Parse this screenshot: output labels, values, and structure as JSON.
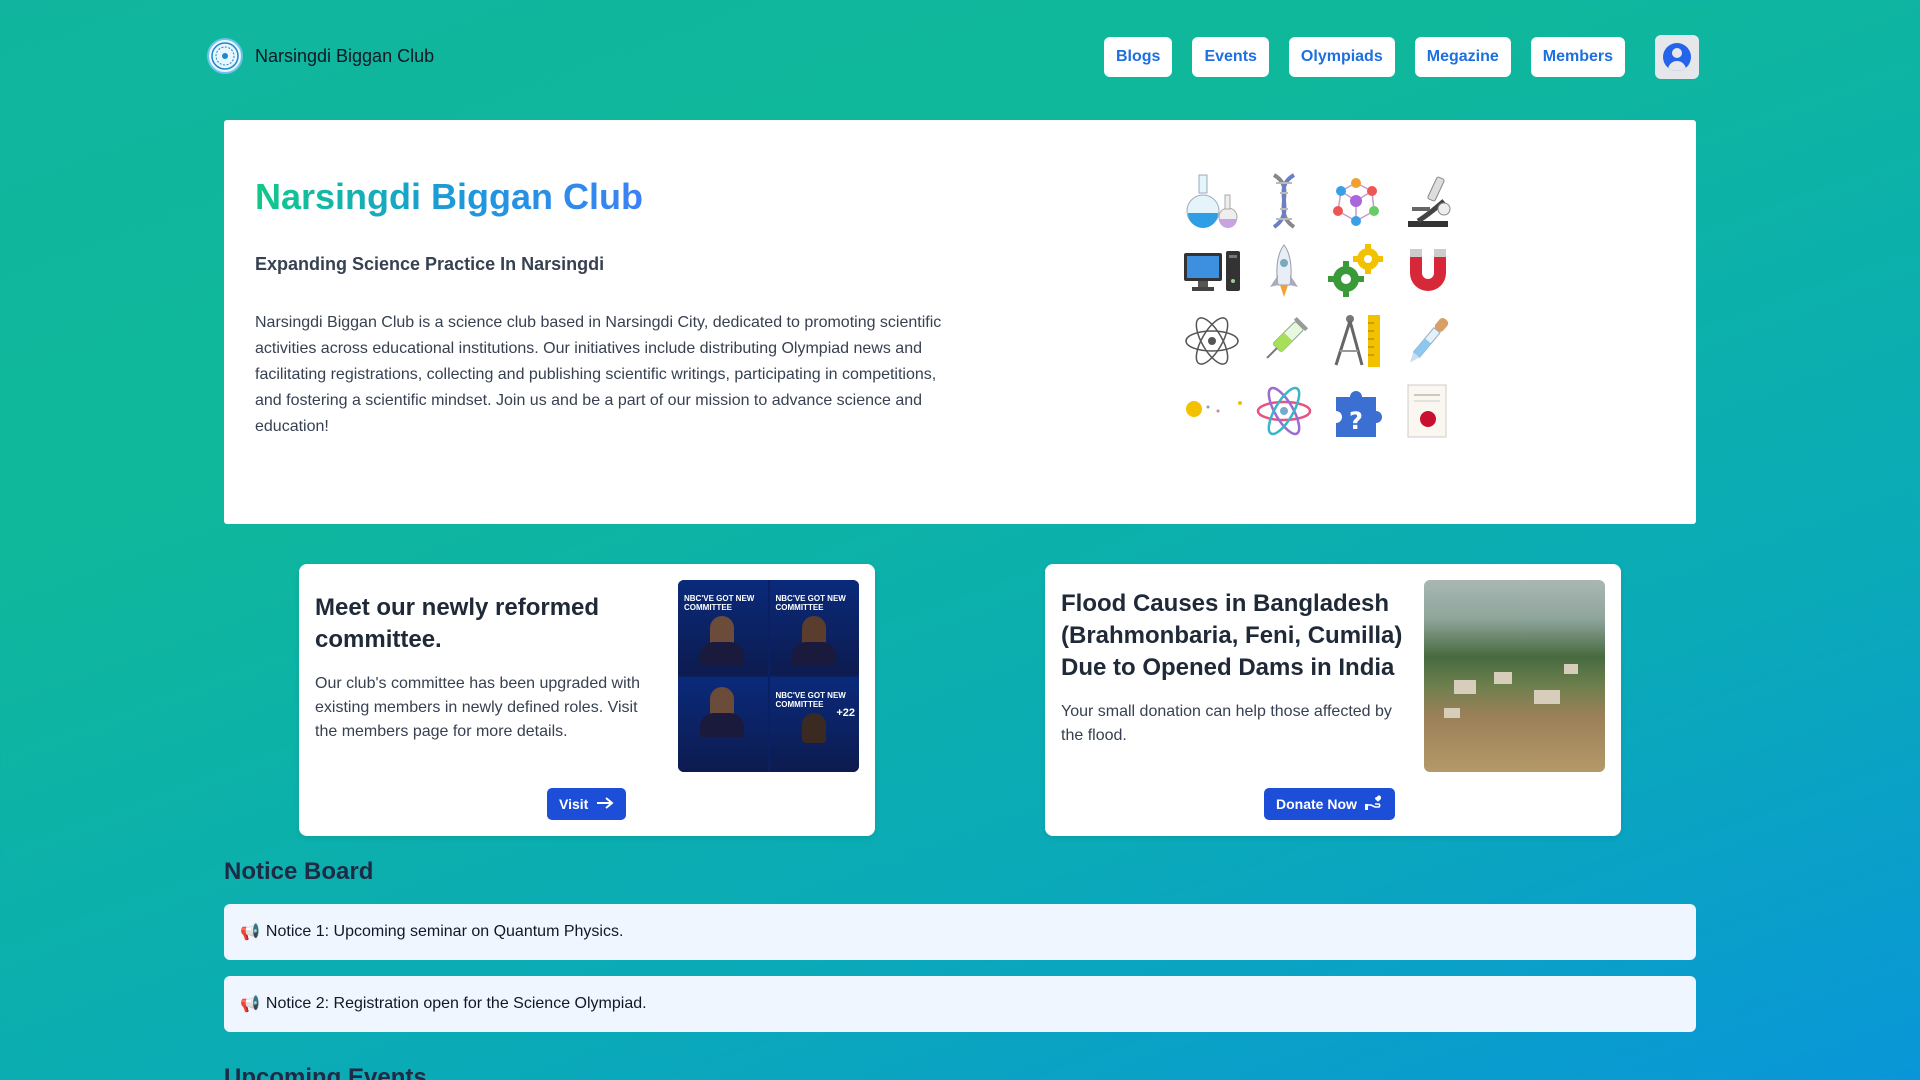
{
  "nav": {
    "brand": "Narsingdi Biggan Club",
    "links": [
      "Blogs",
      "Events",
      "Olympiads",
      "Megazine",
      "Members"
    ]
  },
  "hero": {
    "title": "Narsingdi Biggan Club",
    "subtitle": "Expanding Science Practice In Narsingdi",
    "description": "Narsingdi Biggan Club is a science club based in Narsingdi City, dedicated to promoting scientific activities across educational institutions. Our initiatives include distributing Olympiad news and facilitating registrations, collecting and publishing scientific writings, participating in competitions, and fostering a scientific mindset. Join us and be a part of our mission to advance science and education!",
    "icons": [
      "flasks-icon",
      "dna-icon",
      "molecule-icon",
      "microscope-icon",
      "computer-icon",
      "rocket-icon",
      "gears-icon",
      "magnet-icon",
      "atom-icon",
      "syringe-icon",
      "compass-ruler-icon",
      "dropper-icon",
      "solar-system-icon",
      "atom-color-icon",
      "puzzle-question-icon",
      "diploma-icon"
    ]
  },
  "cards": [
    {
      "title": "Meet our newly reformed committee.",
      "text": "Our club's committee has been upgraded with existing members in newly defined roles. Visit the members page for more details.",
      "button": "Visit",
      "poster": {
        "heading": "NBC'VE GOT NEW COMMITTEE",
        "more": "+22"
      }
    },
    {
      "title": "Flood Causes in Bangladesh (Brahmonbaria, Feni, Cumilla) Due to Opened Dams in India",
      "text": "Your small donation can help those affected by the flood.",
      "button": "Donate Now"
    }
  ],
  "notices": {
    "heading": "Notice Board",
    "items": [
      {
        "icon": "📢",
        "text": "Notice 1: Upcoming seminar on Quantum Physics."
      },
      {
        "icon": "📢",
        "text": "Notice 2: Registration open for the Science Olympiad."
      }
    ]
  },
  "events": {
    "heading": "Upcoming Events"
  },
  "colors": {
    "accent": "#1d4ed8",
    "nav_link": "#1e6fe0",
    "background_start": "#10b59e",
    "background_end": "#0996d8"
  }
}
